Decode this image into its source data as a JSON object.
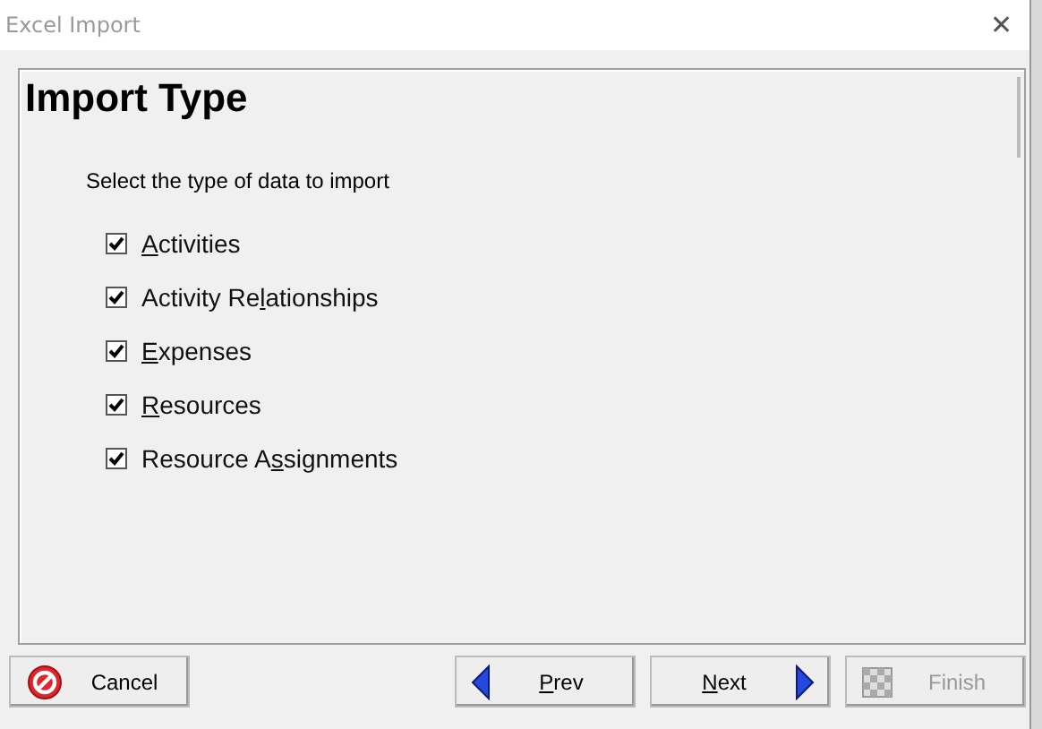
{
  "window": {
    "title": "Excel Import",
    "close": "✕"
  },
  "panel": {
    "heading": "Import Type",
    "instruction": "Select the type of data to import",
    "options": [
      {
        "access_key": "A",
        "label_end": "ctivities",
        "checked": true
      },
      {
        "label_start": "Activity Re",
        "access_key": "l",
        "label_end": "ationships",
        "checked": true
      },
      {
        "access_key": "E",
        "label_end": "xpenses",
        "checked": true
      },
      {
        "access_key": "R",
        "label_end": "esources",
        "checked": true
      },
      {
        "label_start": "Resource A",
        "access_key": "s",
        "label_end": "signments",
        "checked": true
      }
    ]
  },
  "buttons": [
    {
      "kind": "cancel",
      "label_start": "Cancel",
      "disabled": false
    },
    {
      "kind": "prev",
      "access_key": "P",
      "label_end": "rev",
      "disabled": false
    },
    {
      "kind": "next",
      "access_key": "N",
      "label_end": "ext",
      "disabled": false
    },
    {
      "kind": "finish",
      "label_start": "Finish",
      "disabled": true
    }
  ]
}
